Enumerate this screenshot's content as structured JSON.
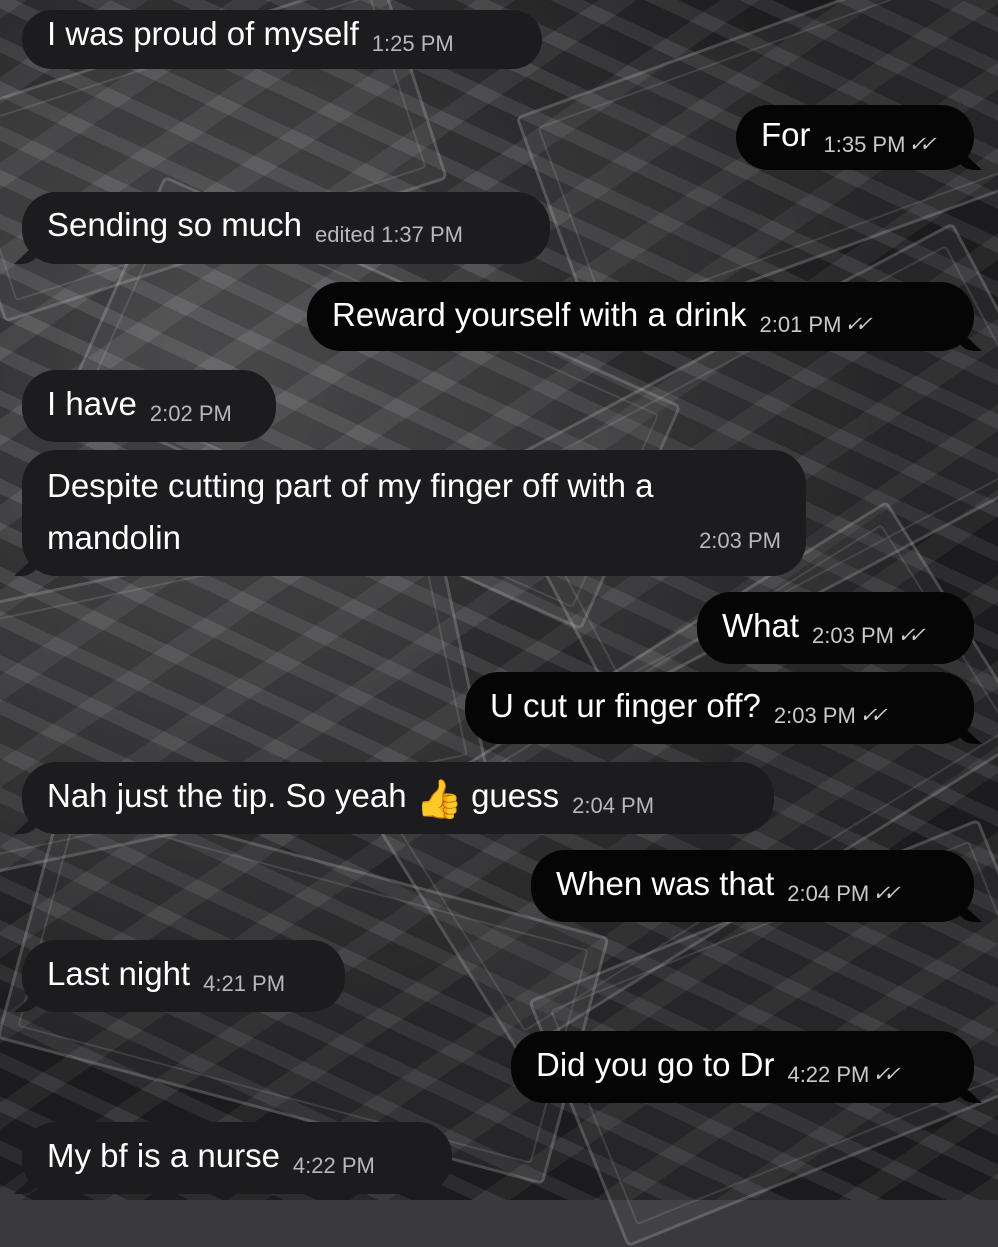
{
  "messages": [
    {
      "direction": "incoming",
      "text": "I was proud of myself",
      "time": "1:25 PM"
    },
    {
      "direction": "outgoing",
      "text": "For",
      "time": "1:35 PM",
      "read": true
    },
    {
      "direction": "incoming",
      "text": "Sending so much",
      "edited_label": "edited",
      "time": "1:37 PM"
    },
    {
      "direction": "outgoing",
      "text": "Reward yourself with a drink",
      "time": "2:01 PM",
      "read": true
    },
    {
      "direction": "incoming",
      "text": "I have",
      "time": "2:02 PM"
    },
    {
      "direction": "incoming",
      "text": "Despite cutting part of my finger off with a mandolin",
      "time": "2:03 PM"
    },
    {
      "direction": "outgoing",
      "text": "What",
      "time": "2:03 PM",
      "read": true
    },
    {
      "direction": "outgoing",
      "text": "U cut ur finger off?",
      "time": "2:03 PM",
      "read": true
    },
    {
      "direction": "incoming",
      "text_before_emoji": "Nah just the tip. So yeah",
      "emoji": "👍",
      "text_after_emoji": "guess",
      "time": "2:04 PM"
    },
    {
      "direction": "outgoing",
      "text": "When was that",
      "time": "2:04 PM",
      "read": true
    },
    {
      "direction": "incoming",
      "text": "Last night",
      "time": "4:21 PM"
    },
    {
      "direction": "outgoing",
      "text": "Did you go to Dr",
      "time": "4:22 PM",
      "read": true
    },
    {
      "direction": "incoming",
      "text": "My bf is a nurse",
      "time": "4:22 PM"
    }
  ],
  "read_receipt_icon": "double-check-icon",
  "colors": {
    "incoming_bubble": "#1c1c1e",
    "outgoing_bubble": "#050505",
    "timestamp": "#b8b8bb"
  }
}
